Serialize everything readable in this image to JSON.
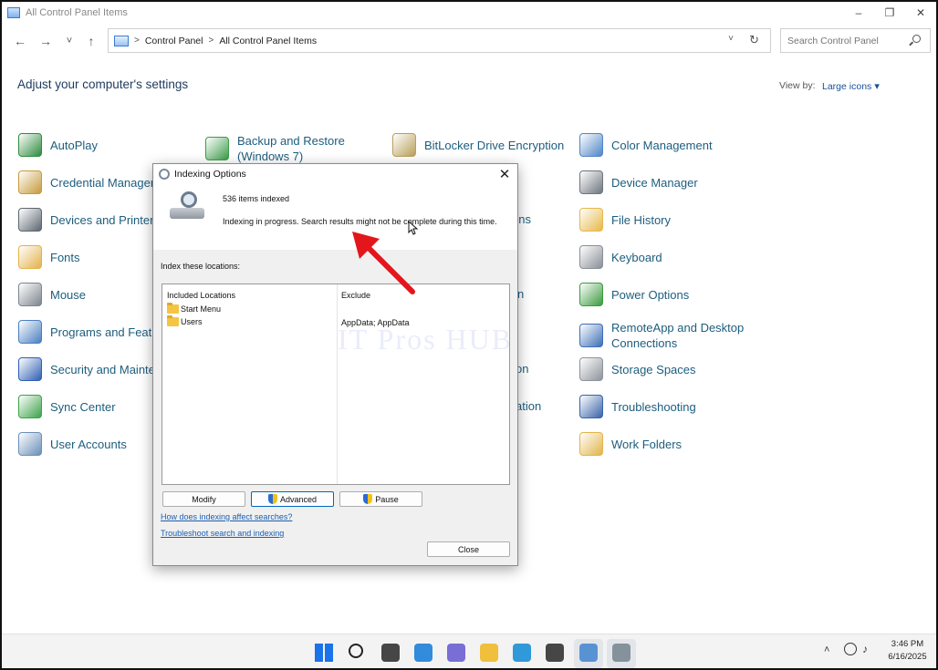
{
  "window": {
    "title": "All Control Panel Items",
    "minimize_glyph": "–",
    "maximize_glyph": "❐",
    "close_glyph": "✕"
  },
  "nav": {
    "back_glyph": "←",
    "forward_glyph": "→",
    "recent_glyph": "˅",
    "up_glyph": "↑",
    "breadcrumb": [
      "Control Panel",
      "All Control Panel Items"
    ],
    "crumb_sep": ">",
    "dropdown_glyph": "˅",
    "refresh_glyph": "↻",
    "search_placeholder": "Search Control Panel"
  },
  "header": {
    "title": "Adjust your computer's settings",
    "view_by_label": "View by:",
    "view_by_value": "Large icons"
  },
  "items": [
    {
      "label": "AutoPlay",
      "icon": "autoplay-icon",
      "color": "#2e8b3d"
    },
    {
      "label": "Backup and Restore\n(Windows 7)",
      "icon": "backup-restore-icon",
      "color": "#3b9c48"
    },
    {
      "label": "BitLocker Drive Encryption",
      "icon": "bitlocker-icon",
      "color": "#b8a05a"
    },
    {
      "label": "Color Management",
      "icon": "color-management-icon",
      "color": "#4f86c6"
    },
    {
      "label": "Credential Manager",
      "icon": "credential-manager-icon",
      "color": "#c79a3b"
    },
    {
      "label": "Device Manager",
      "icon": "device-manager-icon",
      "color": "#6e7680"
    },
    {
      "label": "Devices and Printers",
      "icon": "devices-printers-icon",
      "color": "#5c6670"
    },
    {
      "label": "File History",
      "icon": "file-history-icon",
      "color": "#e6b84a"
    },
    {
      "label": "Fonts",
      "icon": "fonts-icon",
      "color": "#e3b24b"
    },
    {
      "label": "Keyboard",
      "icon": "keyboard-icon",
      "color": "#8a9098"
    },
    {
      "label": "Mouse",
      "icon": "mouse-icon",
      "color": "#7c858e"
    },
    {
      "label": "Power Options",
      "icon": "power-options-icon",
      "color": "#3c9a3f"
    },
    {
      "label": "Programs and Features",
      "icon": "programs-features-icon",
      "color": "#4a7fc1"
    },
    {
      "label": "RemoteApp and Desktop\nConnections",
      "icon": "remoteapp-icon",
      "color": "#3d6fb6"
    },
    {
      "label": "Security and Maintenance",
      "icon": "security-maintenance-icon",
      "color": "#2f5fb3"
    },
    {
      "label": "Storage Spaces",
      "icon": "storage-spaces-icon",
      "color": "#8d949b"
    },
    {
      "label": "Sync Center",
      "icon": "sync-center-icon",
      "color": "#3ca24a"
    },
    {
      "label": "Troubleshooting",
      "icon": "troubleshooting-icon",
      "color": "#3a63a8"
    },
    {
      "label": "User Accounts",
      "icon": "user-accounts-icon",
      "color": "#6a8fb8"
    },
    {
      "label": "Work Folders",
      "icon": "work-folders-icon",
      "color": "#e2b44a"
    }
  ],
  "hidden_fragments": [
    "ons",
    "n",
    "on",
    "ation"
  ],
  "dialog": {
    "title": "Indexing Options",
    "close_glyph": "✕",
    "items_indexed": "536 items indexed",
    "status": "Indexing in progress. Search results might not be complete during this time.",
    "locations_label": "Index these locations:",
    "table": {
      "headers": [
        "Included Locations",
        "Exclude"
      ],
      "rows": [
        {
          "location": "Start Menu",
          "exclude": ""
        },
        {
          "location": "Users",
          "exclude": "AppData; AppData"
        }
      ]
    },
    "buttons": {
      "modify": "Modify",
      "advanced": "Advanced",
      "pause": "Pause",
      "close": "Close"
    },
    "links": {
      "how_indexing": "How does indexing affect searches?",
      "troubleshoot": "Troubleshoot search and indexing"
    }
  },
  "watermark": "IT Pros HUB",
  "taskbar": {
    "apps": [
      "start-icon",
      "search-icon",
      "task-view-icon",
      "widgets-icon",
      "teams-chat-icon",
      "file-explorer-icon",
      "edge-icon",
      "store-icon",
      "control-panel-icon",
      "indexing-options-icon"
    ],
    "tray_chevron": "˄",
    "volume_glyph": "♪",
    "time": "3:46 PM",
    "date": "6/16/2025"
  },
  "colors": {
    "link": "#1d5d7e",
    "accent": "#0067c0",
    "annotation": "#e3161b"
  }
}
